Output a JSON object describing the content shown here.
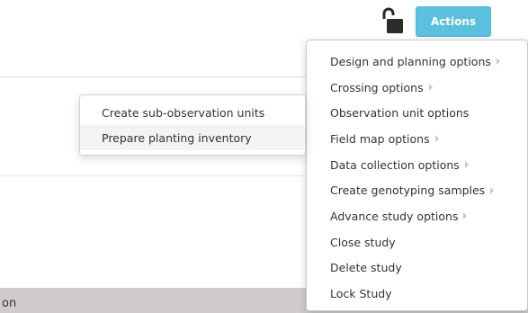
{
  "header": {
    "lock_icon": "unlocked-padlock-icon",
    "actions_label": "Actions",
    "accent": "#5bc0de"
  },
  "background": {
    "bottom_bar_text": "on"
  },
  "actions_menu": {
    "items": [
      {
        "label": "Design and planning options",
        "has_submenu": true
      },
      {
        "label": "Crossing options",
        "has_submenu": true
      },
      {
        "label": "Observation unit options",
        "has_submenu": false
      },
      {
        "label": "Field map options",
        "has_submenu": true
      },
      {
        "label": "Data collection options",
        "has_submenu": true
      },
      {
        "label": "Create genotyping samples",
        "has_submenu": true
      },
      {
        "label": "Advance study options",
        "has_submenu": true
      },
      {
        "label": "Close study",
        "has_submenu": false
      },
      {
        "label": "Delete study",
        "has_submenu": false
      },
      {
        "label": "Lock Study",
        "has_submenu": false
      }
    ]
  },
  "observation_submenu": {
    "items": [
      {
        "label": "Create sub-observation units"
      },
      {
        "label": "Prepare planting inventory"
      }
    ]
  }
}
